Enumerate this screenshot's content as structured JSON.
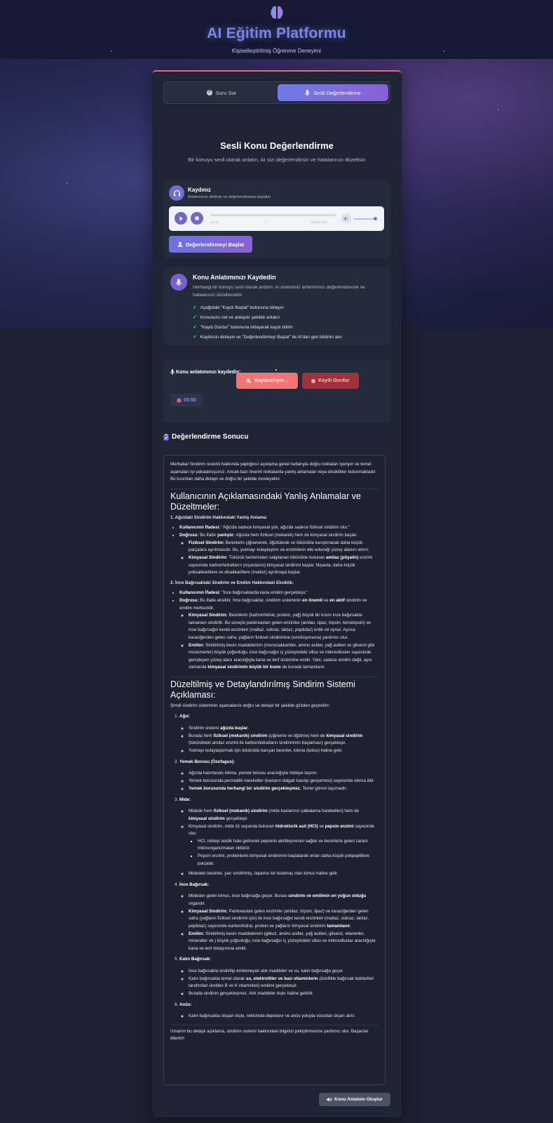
{
  "header": {
    "title": "AI Eğitim Platformu",
    "subtitle": "Kişiselleştirilmiş Öğrenme Deneyimi",
    "logo_icon": "brain-icon"
  },
  "tabs": [
    {
      "label": "Soru Sor",
      "icon": "question-icon",
      "active": false
    },
    {
      "label": "Sesli Değerlendirme",
      "icon": "microphone-icon",
      "active": true
    }
  ],
  "section": {
    "title": "Sesli Konu Değerlendirme",
    "description": "Bir konuyu sesli olarak anlatın, AI sizi değerlendirsin ve hatalarınızı düzeltsin"
  },
  "recording": {
    "title": "Kaydınız",
    "subtitle": "Anlatımınızı dinleyin ve değerlendirmeyi başlatın",
    "player": {
      "current_time": "00:00",
      "separator": "/",
      "duration": "Infinity:NaN",
      "volume": 1.0
    },
    "evaluate_button": "Değerlendirmeyi Başlat"
  },
  "instructions": {
    "title": "Konu Anlatımınızı Kaydedin",
    "description": "Herhangi bir konuyu sesli olarak anlatın. AI sisteminiz anlatımınızı değerlendirecek ve hatalarınızı düzeltecektir.",
    "steps": [
      "Aşağıdaki \"Kaydı Başlat\" butonuna tıklayın",
      "Konunuzu net ve anlaşılır şekilde anlatın",
      "\"Kaydı Durdur\" butonuna tıklayarak kaydı bitirin",
      "Kaydınızı dinleyin ve \"Değerlendirmeyi Başlat\" ile AI'dan geri bildirim alın"
    ]
  },
  "recorder": {
    "label": "Konu anlatımınızı kaydedin:",
    "recording_button": "Kaydediliyor...",
    "stop_button": "Kaydı Durdur",
    "timer": "00:50"
  },
  "result": {
    "title": "Değerlendirme Sonucu",
    "intro": "Merhaba! Sindirim sistemi hakkında yaptığınız açıklama genel hatlarıyla doğru noktaları içeriyor ve temel aşamaları iyi yakalamışsınız. Ancak bazı önemli noktalarda yanlış anlamalar veya eksiklikler bulunmaktadır. Bu kısımları daha detaylı ve doğru bir şekilde inceleyelim.",
    "h_mistakes": "Kullanıcının Açıklamasındaki Yanlış Anlamalar ve Düzeltmeler:",
    "m1_title": "1. Ağızdaki Sindirim Hakkındaki Yanlış Anlama:",
    "m1_stmt_label": "Kullanıcının İfadesi:",
    "m1_stmt": "\"Ağızda sadece kimyasal yok, ağızda sadece fiziksel sindirim olur.\"",
    "m1_true_label": "Doğrusu:",
    "m1_true_a": "Bu ifade",
    "m1_true_b": "yanlıştır",
    "m1_true_c": ". Ağızda hem fiziksel (mekanik) hem de kimyasal sindirim başlar.",
    "m1_phys_label": "Fiziksel Sindirim:",
    "m1_phys": "Besinlerin çiğnenerek, öğütülerek ve tükürükle karıştırılarak daha küçük parçalara ayrılmasıdır. Bu, yutmayı kolaylaştırır ve enzimlerin etki edeceği yüzey alanını artırır.",
    "m1_chem_label": "Kimyasal Sindirim:",
    "m1_chem_a": "Tükürük bezlerinden salgılanan tükürükte bulunan",
    "m1_chem_b": "amilaz (pityalin)",
    "m1_chem_c": "enzimi sayesinde karbonhidratların (nişastanın) kimyasal sindirimi başlar. Nişasta, daha küçük polisakkaritlere ve disakkaritlere (maltoz) ayrılmaya başlar.",
    "m2_title": "2. İnce Bağırsaktaki Sindirim ve Emilim Hakkındaki Eksiklik:",
    "m2_stmt_label": "Kullanıcının İfadesi:",
    "m2_stmt": "\"İnce bağırsaklarda kana emilim gerçekleşir.\"",
    "m2_true_label": "Doğrusu:",
    "m2_true_a": "Bu ifade eksiktir. İnce bağırsaklar, sindirim sisteminin",
    "m2_true_b": "en önemli",
    "m2_true_c": "ve",
    "m2_true_d": "en aktif",
    "m2_true_e": "sindirim ve emilim merkezidir.",
    "m2_chem_label": "Kimyasal Sindirim:",
    "m2_chem": "Besinlerin (karbonhidrat, protein, yağ) büyük bir kısmı ince bağırsakta tamamen sindirilir. Bu süreçte pankreastan gelen enzimler (amilaz, lipaz, tripsin, kimotripsin) ve ince bağırsağın kendi enzimleri (maltaz, sükraz, laktaz, peptidaz) kritik rol oynar. Ayrıca karaciğerden gelen safra, yağların fiziksel sindirimine (emülsiyonuna) yardımcı olur.",
    "m2_abs_label": "Emilim:",
    "m2_abs_a": "Sindirilmiş besin maddelerinin (monosakkaritler, amino asitler, yağ asitleri ve gliserol gibi monomerler) büyük çoğunluğu, ince bağırsağın iç yüzeyindeki villus ve mikrovillusler sayesinde genişleyen yüzey alanı aracılığıyla kana ve lenf sistemine emilir. Yani, sadece emilim değil, aynı zamanda",
    "m2_abs_b": "kimyasal sindirimin büyük bir kısmı",
    "m2_abs_c": "da burada tamamlanır.",
    "h_corrected": "Düzeltilmiş ve Detaylandırılmış Sindirim Sistemi Açıklaması:",
    "corrected_intro": "Şimdi sindirim sisteminin aşamalarını doğru ve detaylı bir şekilde gözden geçirelim:",
    "s1_title": "Ağız:",
    "s1_i1_a": "Sindirim sistemi",
    "s1_i1_b": "ağızda başlar",
    "s1_i1_c": ".",
    "s1_i2_a": "Burada hem",
    "s1_i2_b": "fiziksel (mekanik) sindirim",
    "s1_i2_c": "(çiğneme ve öğütme) hem de",
    "s1_i2_d": "kimyasal sindirim",
    "s1_i2_e": "(tükürükteki amilaz enzimi ile karbonhidratların sindiriminin başlaması) gerçekleşir.",
    "s1_i3": "Yutmayı kolaylaştırmak için tükürükle karışan besinler, lokma (bolus) haline gelir.",
    "s2_title": "Yemek Borusu (Özofagus):",
    "s2_i1": "Ağızda hazırlanan lokma, yemek borusu aracılığıyla mideye taşınır.",
    "s2_i2": "Yemek borusunda peristaltik hareketler (kasların dalgalı kasılıp gevşemesi) sayesinde lokma itilir.",
    "s2_i3_a": "Yemek borusunda herhangi bir sindirim gerçekleşmez.",
    "s2_i3_b": "Temel görevi taşımadır.",
    "s3_title": "Mide:",
    "s3_i1_a": "Midede hem",
    "s3_i1_b": "fiziksel (mekanik) sindirim",
    "s3_i1_c": "(mide kaslarının çalkalama hareketleri) hem de",
    "s3_i1_d": "kimyasal sindirim",
    "s3_i1_e": "gerçekleşir.",
    "s3_i2_a": "Kimyasal sindirim, mide öz suyunda bulunan",
    "s3_i2_b": "hidroklorik asit (HCl)",
    "s3_i2_c": "ve",
    "s3_i2_d": "pepsin enzimi",
    "s3_i2_e": "sayesinde olur.",
    "s3_sub1": "HCl, mideyi asidik hale getirerek pepsinin aktifleşmesini sağlar ve besinlerle gelen zararlı mikroorganizmaları öldürür.",
    "s3_sub2": "Pepsin enzimi, proteinlerin kimyasal sindirimini başlatarak onları daha küçük polipeptitlere parçalar.",
    "s3_i3": "Midedeki besinler, yarı sindirilmiş, lapamsı bir bulamaç olan kimus haline gelir.",
    "s4_title": "İnce Bağırsak:",
    "s4_i1_a": "Mideden gelen kimus, ince bağırsağa geçer. Burası",
    "s4_i1_b": "sindirim ve emilimin en yoğun olduğu",
    "s4_i1_c": "organdır.",
    "s4_i2_label": "Kimyasal Sindirim:",
    "s4_i2_a": "Pankreastan gelen enzimler (amilaz, tripsin, lipaz) ve karaciğerden gelen safra (yağların fiziksel sindirimi için) ile ince bağırsağın kendi enzimleri (maltaz, sükraz, laktaz, peptidaz) sayesinde karbonhidrat, protein ve yağların kimyasal sindirimi",
    "s4_i2_b": "tamamlanır",
    "s4_i2_c": ".",
    "s4_i3_label": "Emilim:",
    "s4_i3": "Sindirilmiş besin maddelerinin (glikoz, amino asitler, yağ asitleri, gliserol, vitaminler, mineraller vb.) büyük çoğunluğu, ince bağırsağın iç yüzeyindeki villus ve mikrovilluslar aracılığıyla kana ve lenf dolaşımına emilir.",
    "s5_title": "Kalın Bağırsak:",
    "s5_i1": "İnce bağırsakta sindirilip emilemeyen atık maddeler ve su, kalın bağırsağa geçer.",
    "s5_i2_a": "Kalın bağırsakta temel olarak",
    "s5_i2_b": "su, elektrolitler ve bazı vitaminlerin",
    "s5_i2_c": "(özellikle bağırsak bakterileri tarafından üretilen B ve K vitaminleri) emilimi gerçekleşir.",
    "s5_i3": "Burada sindirim gerçekleşmez. Atık maddeler dışkı haline getirilir.",
    "s6_title": "Anüs:",
    "s6_i1": "Kalın bağırsakta oluşan dışkı, rektumda depolanır ve anüs yoluyla vücuttan dışarı atılır.",
    "closing": "Umarım bu detaylı açıklama, sindirim sistemi hakkındaki bilginizi pekiştirmenize yardımcı olur. Başarılar dilerim!"
  },
  "footer_button": "Konu Anlatımı Oluştur",
  "colors": {
    "accent": "#6f7be8",
    "accent_purple": "#8a5fd6",
    "recording_red": "#f47474",
    "stop_red": "#a2303a",
    "check_green": "#4ade80"
  }
}
